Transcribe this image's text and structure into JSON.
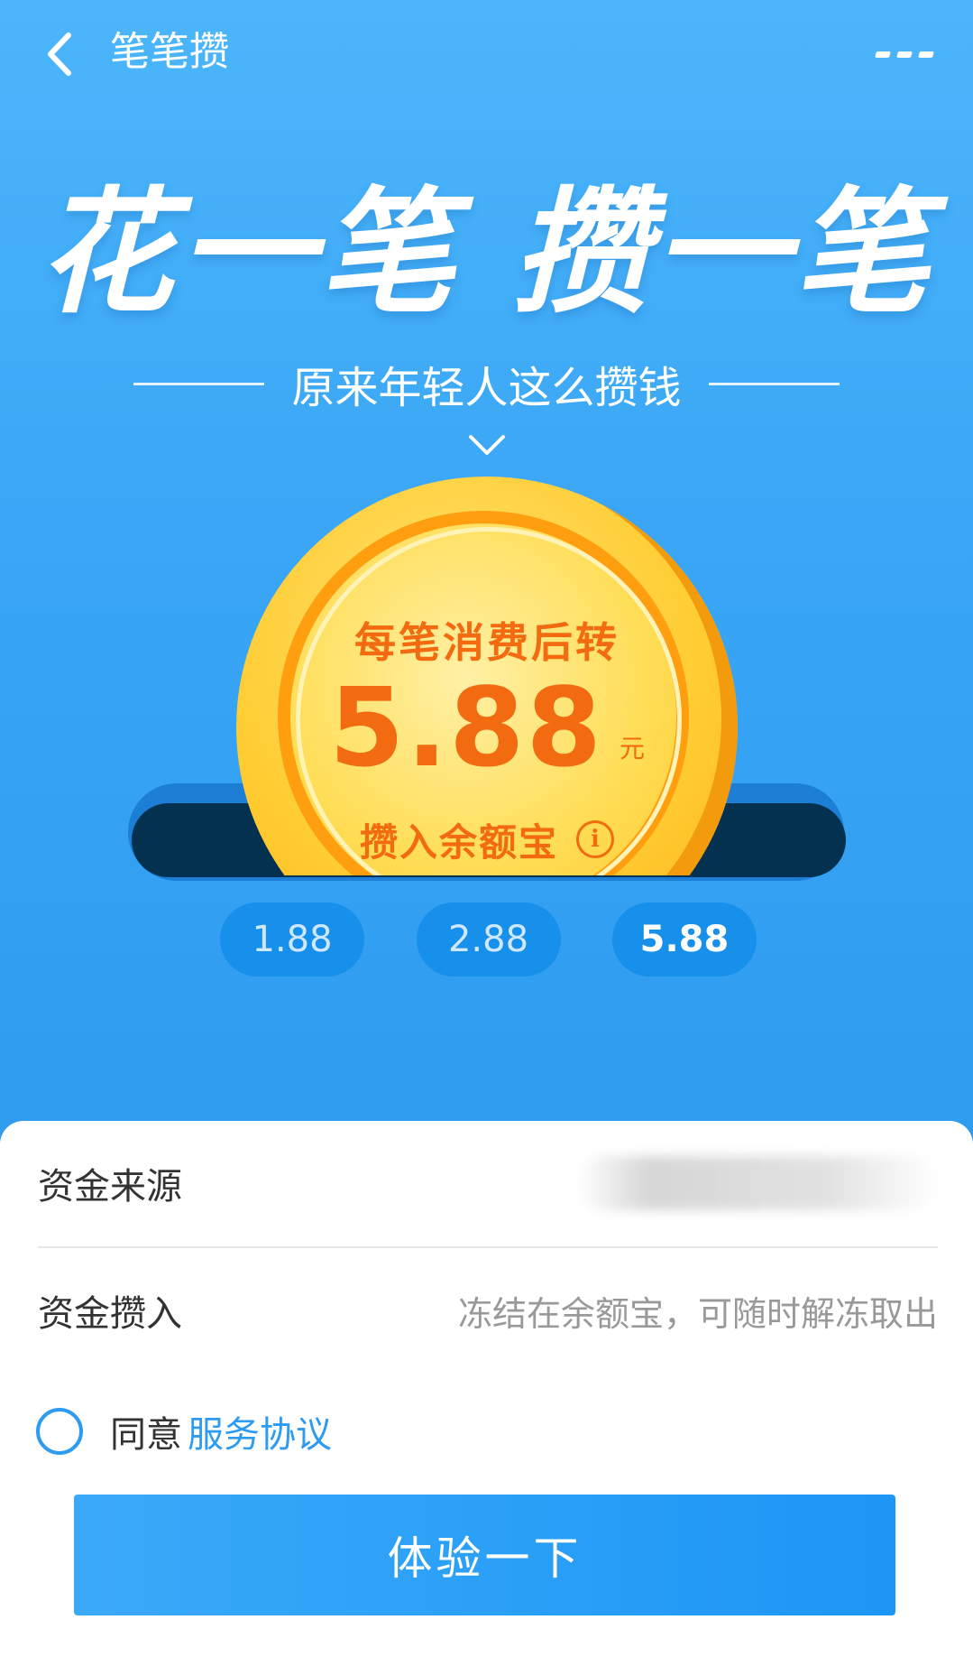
{
  "nav": {
    "back_icon": "chevron-left-icon",
    "title": "笔笔攒",
    "more_icon": "more-dots-icon"
  },
  "hero": {
    "headline": "花一笔 攒一笔",
    "subline": "原来年轻人这么攒钱",
    "down_icon": "chevron-down-icon"
  },
  "coin": {
    "label_top": "每笔消费后转",
    "amount": "5.88",
    "unit": "元",
    "label_bottom": "攒入余额宝",
    "info_icon": "info-icon",
    "info_glyph": "i"
  },
  "options": [
    {
      "label": "1.88",
      "selected": false
    },
    {
      "label": "2.88",
      "selected": false
    },
    {
      "label": "5.88",
      "selected": true
    }
  ],
  "form": {
    "source_label": "资金来源",
    "deposit_label": "资金攒入",
    "deposit_value": "冻结在余额宝，可随时解冻取出"
  },
  "agreement": {
    "agree_text": "同意",
    "link_text": "服务协议",
    "checked": false
  },
  "cta": {
    "label": "体验一下"
  },
  "colors": {
    "hero_blue": "#3aa6f5",
    "coin_orange": "#f26b10",
    "link_blue": "#2d9bf0"
  }
}
